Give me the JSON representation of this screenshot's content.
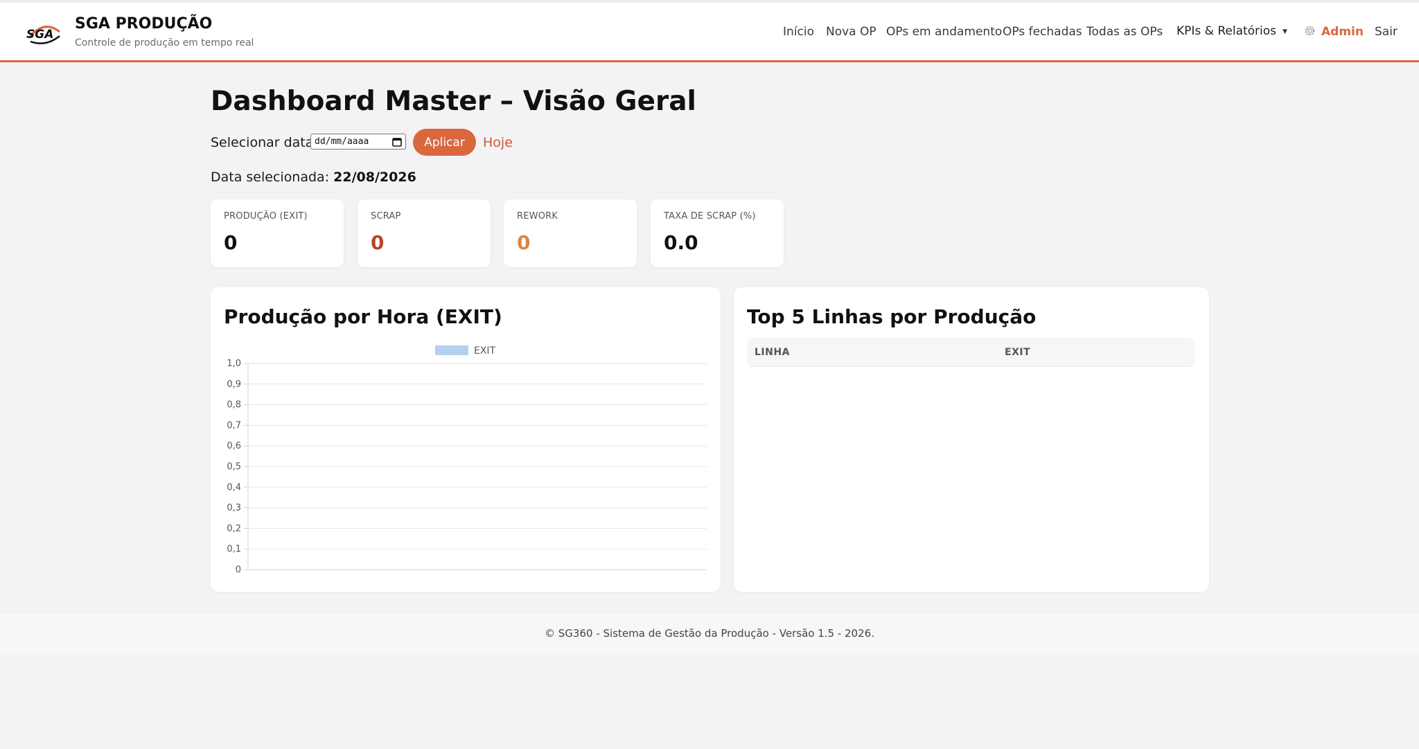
{
  "brand": {
    "title": "SGA PRODUÇÃO",
    "subtitle": "Controle de produção em tempo real",
    "logo_text": "SGA"
  },
  "nav": {
    "items": [
      "Início",
      "Nova OP",
      "OPs em andamento",
      "OPs fechadas",
      "Todas as OPs"
    ],
    "dropdown_label": "KPIs & Relatórios",
    "admin_label": "Admin",
    "logout_label": "Sair"
  },
  "page": {
    "title": "Dashboard Master – Visão Geral",
    "date_label": "Selecionar data:",
    "date_placeholder": "dd/mm/aaaa",
    "apply_label": "Aplicar",
    "today_label": "Hoje",
    "selected_label": "Data selecionada:",
    "selected_value": "22/08/2026"
  },
  "kpis": [
    {
      "label": "PRODUÇÃO (EXIT)",
      "value": "0",
      "color": "#111111"
    },
    {
      "label": "SCRAP",
      "value": "0",
      "color": "#b5472a"
    },
    {
      "label": "REWORK",
      "value": "0",
      "color": "#d9883f"
    },
    {
      "label": "TAXA DE SCRAP (%)",
      "value": "0.0",
      "color": "#111111"
    }
  ],
  "chart": {
    "title": "Produção por Hora (EXIT)"
  },
  "chart_data": {
    "type": "bar",
    "title": "Produção por Hora (EXIT)",
    "categories": [],
    "series": [
      {
        "name": "EXIT",
        "values": []
      }
    ],
    "ylim": [
      0,
      1
    ],
    "y_ticks": [
      "0",
      "0,1",
      "0,2",
      "0,3",
      "0,4",
      "0,5",
      "0,6",
      "0,7",
      "0,8",
      "0,9",
      "1,0"
    ],
    "grid": true,
    "legend": "top-center",
    "series_color": "#b3d1ee"
  },
  "top_lines": {
    "title": "Top 5 Linhas por Produção",
    "columns": [
      "LINHA",
      "EXIT"
    ],
    "rows": []
  },
  "footer": {
    "text": "© SG360 - Sistema de Gestão da Produção - Versão 1.5 - 2026."
  },
  "colors": {
    "accent": "#d9683f",
    "background": "#f3f3f5",
    "card": "#ffffff"
  }
}
